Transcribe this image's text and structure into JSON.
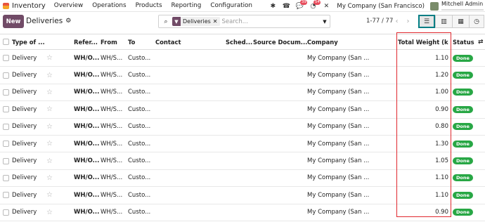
{
  "nav": {
    "app_name": "Inventory",
    "menu": [
      "Overview",
      "Operations",
      "Products",
      "Reporting",
      "Configuration"
    ],
    "messages_count": "39",
    "activities_count": "54",
    "company": "My Company (San Francisco)",
    "user": "Mitchell Admin"
  },
  "control": {
    "new_label": "New",
    "title": "Deliveries",
    "facet": "Deliveries",
    "search_placeholder": "Search...",
    "pager": "1-77 / 77"
  },
  "table": {
    "headers": {
      "type": "Type of ...",
      "reference": "Refer...",
      "from": "From",
      "to": "To",
      "contact": "Contact",
      "scheduled": "Sched...",
      "source": "Source Docum...",
      "company": "Company",
      "weight": "Total Weight (kg)",
      "status": "Status"
    },
    "rows": [
      {
        "type": "Delivery",
        "ref": "WH/O...",
        "from": "WH/S...",
        "to": "Custo...",
        "company": "My Company (San ...",
        "weight": "1.10",
        "status": "Done"
      },
      {
        "type": "Delivery",
        "ref": "WH/O...",
        "from": "WH/S...",
        "to": "Custo...",
        "company": "My Company (San ...",
        "weight": "1.20",
        "status": "Done"
      },
      {
        "type": "Delivery",
        "ref": "WH/O...",
        "from": "WH/S...",
        "to": "Custo...",
        "company": "My Company (San ...",
        "weight": "1.00",
        "status": "Done"
      },
      {
        "type": "Delivery",
        "ref": "WH/O...",
        "from": "WH/S...",
        "to": "Custo...",
        "company": "My Company (San ...",
        "weight": "0.90",
        "status": "Done"
      },
      {
        "type": "Delivery",
        "ref": "WH/O...",
        "from": "WH/S...",
        "to": "Custo...",
        "company": "My Company (San ...",
        "weight": "0.80",
        "status": "Done"
      },
      {
        "type": "Delivery",
        "ref": "WH/O...",
        "from": "WH/S...",
        "to": "Custo...",
        "company": "My Company (San ...",
        "weight": "1.30",
        "status": "Done"
      },
      {
        "type": "Delivery",
        "ref": "WH/O...",
        "from": "WH/S...",
        "to": "Custo...",
        "company": "My Company (San ...",
        "weight": "1.05",
        "status": "Done"
      },
      {
        "type": "Delivery",
        "ref": "WH/O...",
        "from": "WH/S...",
        "to": "Custo...",
        "company": "My Company (San ...",
        "weight": "1.10",
        "status": "Done"
      },
      {
        "type": "Delivery",
        "ref": "WH/O...",
        "from": "WH/S...",
        "to": "Custo...",
        "company": "My Company (San ...",
        "weight": "1.10",
        "status": "Done"
      },
      {
        "type": "Delivery",
        "ref": "WH/O...",
        "from": "WH/S...",
        "to": "Custo...",
        "company": "My Company (San ...",
        "weight": "0.90",
        "status": "Done"
      }
    ]
  },
  "colors": {
    "brand": "#714b67",
    "done_badge": "#28a745",
    "highlight": "#e0282e"
  }
}
